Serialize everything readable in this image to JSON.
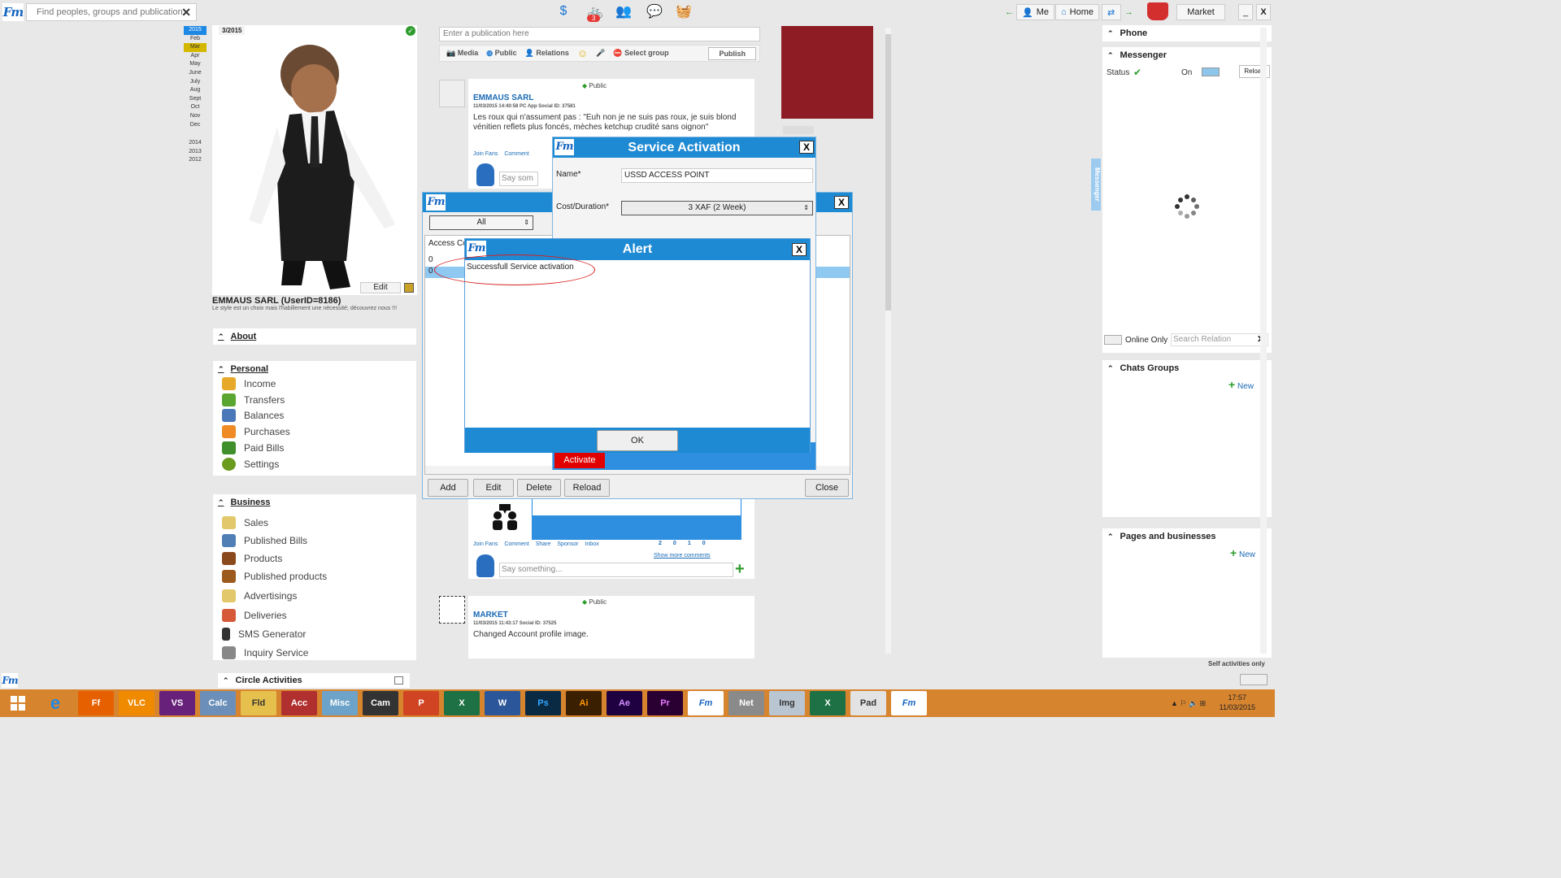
{
  "topbar": {
    "search_placeholder": "Find peoples, groups and publications",
    "notification_count": "3",
    "me_label": "Me",
    "home_label": "Home",
    "market_label": "Market",
    "minimize": "_",
    "close": "X"
  },
  "calendar": {
    "year": "2015",
    "months": [
      "Feb",
      "Mar",
      "Apr",
      "May",
      "June",
      "July",
      "Aug",
      "Sept",
      "Oct",
      "Nov",
      "Dec"
    ],
    "selected_month": "Mar",
    "years": [
      "2014",
      "2013",
      "2012"
    ]
  },
  "profile": {
    "date": "3/2015",
    "edit_label": "Edit",
    "name": "EMMAUS SARL (UserID=8186)",
    "tagline": "Le style est un choix mais l'habillement une nécessité; découvrez nous !!!"
  },
  "about": {
    "title": "About"
  },
  "personal": {
    "title": "Personal",
    "items": [
      "Income",
      "Transfers",
      "Balances",
      "Purchases",
      "Paid Bills",
      "Settings"
    ]
  },
  "business": {
    "title": "Business",
    "items": [
      "Sales",
      "Published Bills",
      "Products",
      "Published products",
      "Advertisings",
      "Deliveries",
      "SMS Generator",
      "Inquiry Service"
    ]
  },
  "circle": {
    "title": "Circle Activities"
  },
  "publish": {
    "placeholder": "Enter a publication here",
    "media": "Media",
    "public": "Public",
    "relations": "Relations",
    "select_group": "Select group",
    "publish_btn": "Publish"
  },
  "post1": {
    "visibility": "Public",
    "author": "EMMAUS SARL",
    "meta": "11/03/2015 14:40:58  PC App  Social ID: 37581",
    "text": "Les roux qui n'assument pas : \"Euh non je ne suis pas roux, je suis blond vénitien reflets plus foncés, mèches ketchup crudité sans oignon\"",
    "links": [
      "Join Fans",
      "Comment"
    ],
    "say": "Say som"
  },
  "post2": {
    "links": [
      "Join Fans",
      "Comment",
      "Share",
      "Sponsor",
      "Inbox"
    ],
    "show_more": "Show more comments",
    "counts": [
      "2",
      "0",
      "1",
      "0"
    ],
    "say": "Say something..."
  },
  "post3": {
    "visibility": "Public",
    "author": "MARKET",
    "meta": "11/03/2015 11:43:17  Social ID: 37525",
    "text": "Changed Account profile image."
  },
  "right": {
    "phone": "Phone",
    "messenger": "Messenger",
    "status": "Status",
    "on": "On",
    "reload": "Reload",
    "online_only": "Online Only",
    "search_relation": "Search Relation",
    "chats_groups": "Chats Groups",
    "new1": "New",
    "pages": "Pages and businesses",
    "new2": "New",
    "self_activities": "Self activities only",
    "vertical_tab": "Messenger"
  },
  "list_dialog": {
    "filter": "All",
    "col_header": "Access Cod",
    "rows": [
      "0",
      "0"
    ],
    "add": "Add",
    "edit": "Edit",
    "delete": "Delete",
    "reload": "Reload",
    "close": "Close",
    "close_x": "X"
  },
  "service": {
    "title": "Service Activation",
    "name_label": "Name*",
    "name_value": "USSD ACCESS POINT",
    "cost_label": "Cost/Duration*",
    "cost_value": "3 XAF (2 Week)",
    "activate": "Activate",
    "close_x": "X"
  },
  "alert": {
    "title": "Alert",
    "message": "Successfull Service activation",
    "ok": "OK",
    "close_x": "X"
  },
  "taskbar": {
    "time": "17:57",
    "date": "11/03/2015",
    "apps": [
      "e",
      "Ff",
      "VLC",
      "VS",
      "Calc",
      "Fld",
      "Acc",
      "Misc",
      "Cam",
      "P",
      "X",
      "W",
      "Ps",
      "Ai",
      "Ae",
      "Pr",
      "Fm",
      "Net",
      "Img",
      "X",
      "Pad",
      "Fm"
    ]
  }
}
